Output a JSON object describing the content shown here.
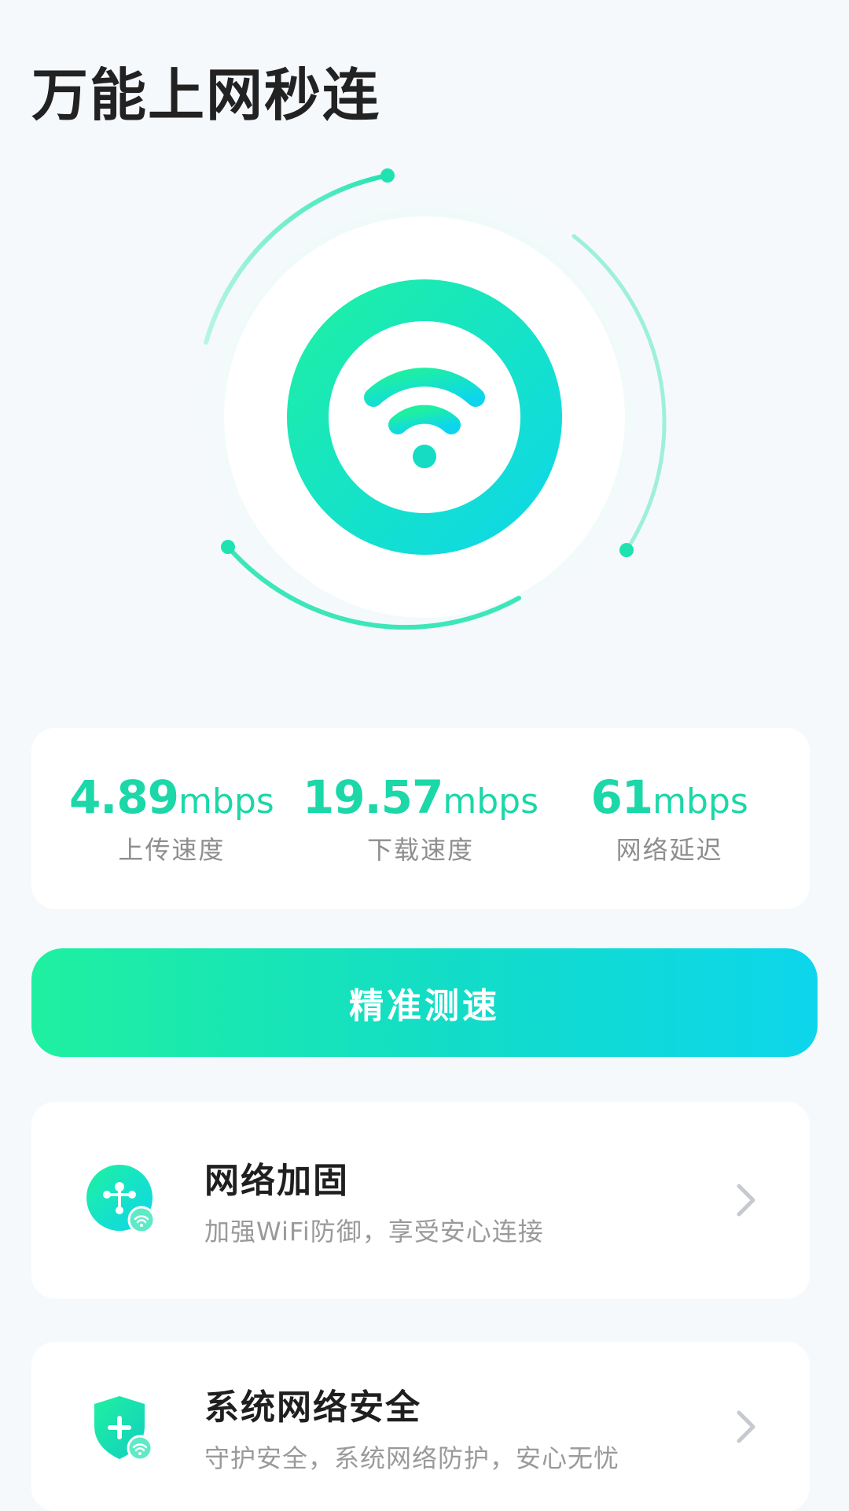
{
  "header": {
    "title": "万能上网秒连"
  },
  "hero": {
    "icon": "wifi-icon",
    "colors": {
      "accent_start": "#1ff0a0",
      "accent_end": "#0dd6ec"
    }
  },
  "stats": [
    {
      "value": "4.89",
      "unit": "mbps",
      "label": "上传速度"
    },
    {
      "value": "19.57",
      "unit": "mbps",
      "label": "下载速度"
    },
    {
      "value": "61",
      "unit": "mbps",
      "label": "网络延迟"
    }
  ],
  "primary_action": {
    "label": "精准测速",
    "colors": {
      "start": "#1ff0a0",
      "end": "#0dd6ec"
    }
  },
  "features": [
    {
      "title": "网络加固",
      "subtitle": "加强WiFi防御，享受安心连接",
      "icon": "network-hub-icon"
    },
    {
      "title": "系统网络安全",
      "subtitle": "守护安全，系统网络防护，安心无忧",
      "icon": "shield-plus-icon"
    }
  ],
  "colors": {
    "background": "#f6f9fc",
    "card": "#ffffff",
    "stat_text": "#1cd7a8",
    "secondary_text": "#8e8e8e"
  }
}
